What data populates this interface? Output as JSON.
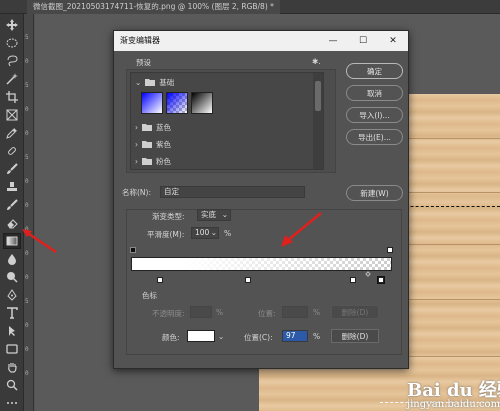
{
  "document_tab": {
    "title": "微信截图_20210503174711-恢复的.png @ 100% (图层 2, RGB/8) *"
  },
  "ruler_numbers": [
    "5",
    "0",
    "5",
    "0",
    "0",
    "5",
    "0",
    "0",
    "0",
    "0",
    "0",
    "5",
    "0",
    "0",
    "0"
  ],
  "dialog": {
    "title": "渐变编辑器",
    "minimize": "—",
    "maximize": "☐",
    "close": "✕",
    "presets_label": "预设",
    "presets_gear": "✱.",
    "folders": [
      {
        "name": "基础",
        "expanded": true
      },
      {
        "name": "蓝色",
        "expanded": false
      },
      {
        "name": "紫色",
        "expanded": false
      },
      {
        "name": "粉色",
        "expanded": false
      }
    ],
    "buttons": {
      "ok": "确定",
      "cancel": "取消",
      "import": "导入(I)...",
      "export": "导出(E)...",
      "new": "新建(W)"
    },
    "name_label": "名称(N):",
    "name_value": "自定",
    "gradient_type_label": "渐变类型:",
    "gradient_type_value": "实底",
    "smoothness_label": "平滑度(M):",
    "smoothness_value": "100",
    "smoothness_unit": "%",
    "stops_label": "色标",
    "opacity_label": "不透明度:",
    "opacity_unit": "%",
    "location_label_top": "位置:",
    "location_unit_top": "%",
    "delete_top": "删除(D)",
    "color_label": "颜色:",
    "location_label": "位置(C):",
    "location_value": "97",
    "location_unit": "%",
    "delete_bottom": "删除(D)"
  },
  "watermark": {
    "brand": "Bai du 经验",
    "url": "jingyan.baidu.com"
  },
  "colors": {
    "accent_arrow": "#e0201c",
    "dialog_bg": "#535353",
    "selected_field": "#2d5aa8"
  }
}
